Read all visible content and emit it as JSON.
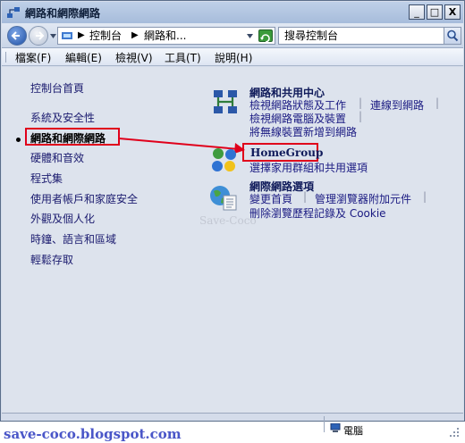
{
  "window": {
    "title": "網路和網際網路"
  },
  "window_controls": {
    "minimize": "_",
    "maximize": "□",
    "close": "X"
  },
  "address": {
    "crumb_1": "控制台",
    "crumb_2": "網路和...",
    "search_placeholder": "搜尋控制台"
  },
  "menu": [
    "檔案(F)",
    "編輯(E)",
    "檢視(V)",
    "工具(T)",
    "說明(H)"
  ],
  "sidebar": {
    "home": "控制台首頁",
    "items": [
      "系統及安全性",
      "網路和網際網路",
      "硬體和音效",
      "程式集",
      "使用者帳戶和家庭安全",
      "外觀及個人化",
      "時鐘、語言和區域",
      "輕鬆存取"
    ],
    "current_index": 1
  },
  "categories": {
    "network_center": {
      "title": "網路和共用中心",
      "links": [
        "檢視網路狀態及工作",
        "連線到網路",
        "檢視網路電腦及裝置",
        "將無線裝置新增到網路"
      ]
    },
    "homegroup": {
      "title": "HomeGroup",
      "links": [
        "選擇家用群組和共用選項"
      ]
    },
    "internet_options": {
      "title": "網際網路選項",
      "links": [
        "變更首頁",
        "管理瀏覽器附加元件",
        "刪除瀏覽歷程記錄及 Cookie"
      ]
    }
  },
  "watermark": "Save-Coco",
  "status": {
    "computer": "電腦"
  },
  "footer": "save-coco.blogspot.com",
  "colors": {
    "highlight_red": "#e0001b",
    "link_blue": "#1a1a82"
  }
}
